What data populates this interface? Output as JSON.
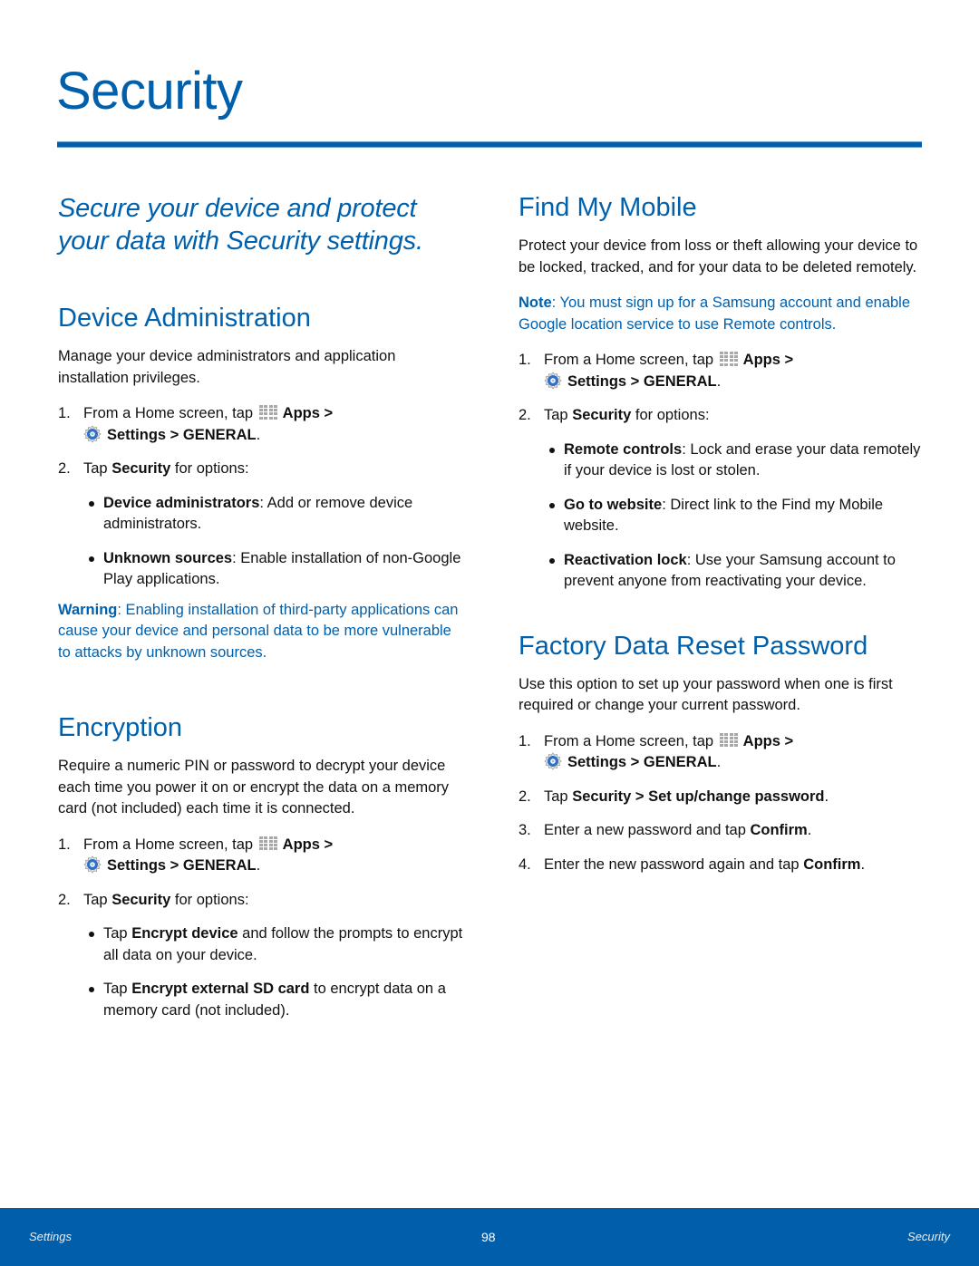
{
  "page": {
    "title": "Security",
    "intro": "Secure your device and protect your data with Security settings."
  },
  "common_step1": {
    "num": "1.",
    "prefix": "From a Home screen, tap",
    "apps": "Apps",
    "sep1": " >",
    "settings": "Settings > GENERAL",
    "end": "."
  },
  "device_admin": {
    "heading": "Device Administration",
    "body": "Manage your device administrators and application installation privileges.",
    "step2": {
      "num": "2.",
      "pre": "Tap ",
      "bold": "Security",
      "post": " for options:"
    },
    "bullets": [
      {
        "bold": "Device administrators",
        "text": ": Add or remove device administrators."
      },
      {
        "bold": "Unknown sources",
        "text": ": Enable installation of non-Google Play applications."
      }
    ],
    "warning": {
      "label": "Warning",
      "text": ": Enabling installation of third-party applications can cause your device and personal data to be more vulnerable to attacks by unknown sources."
    }
  },
  "encryption": {
    "heading": "Encryption",
    "body": "Require a numeric PIN or password to decrypt your device each time you power it on or encrypt the data on a memory card (not included) each time it is connected.",
    "step2": {
      "num": "2.",
      "pre": "Tap ",
      "bold": "Security",
      "post": " for options:"
    },
    "bullets": [
      {
        "pre": "Tap ",
        "bold": "Encrypt device",
        "text": " and follow the prompts to encrypt all data on your device."
      },
      {
        "pre": "Tap ",
        "bold": "Encrypt external SD card",
        "text": " to encrypt data on a memory card (not included)."
      }
    ]
  },
  "find_my_mobile": {
    "heading": "Find My Mobile",
    "body": "Protect your device from loss or theft allowing your device to be locked, tracked, and for your data to be deleted remotely.",
    "note": {
      "label": "Note",
      "text": ": You must sign up for a Samsung account and enable Google location service to use Remote controls."
    },
    "step2": {
      "num": "2.",
      "pre": "Tap ",
      "bold": "Security",
      "post": " for options:"
    },
    "bullets": [
      {
        "bold": "Remote controls",
        "text": ": Lock and erase your data remotely if your device is lost or stolen."
      },
      {
        "bold": "Go to website",
        "text": ": Direct link to the Find my Mobile website."
      },
      {
        "bold": "Reactivation lock",
        "text": ": Use your Samsung account to prevent anyone from reactivating your device."
      }
    ]
  },
  "factory_reset": {
    "heading": "Factory Data Reset Password",
    "body": "Use this option to set up your password when one is first required or change your current password.",
    "steps": [
      {
        "num": "2.",
        "pre": "Tap ",
        "bold": "Security > Set up/change password",
        "post": "."
      },
      {
        "num": "3.",
        "pre": "Enter a new password and tap ",
        "bold": "Confirm",
        "post": "."
      },
      {
        "num": "4.",
        "pre": "Enter the new password again and tap ",
        "bold": "Confirm",
        "post": "."
      }
    ]
  },
  "footer": {
    "left": "Settings",
    "page_number": "98",
    "right": "Security"
  },
  "colors": {
    "accent": "#0060ac",
    "footer_bg": "#005eab",
    "text": "#111111"
  }
}
